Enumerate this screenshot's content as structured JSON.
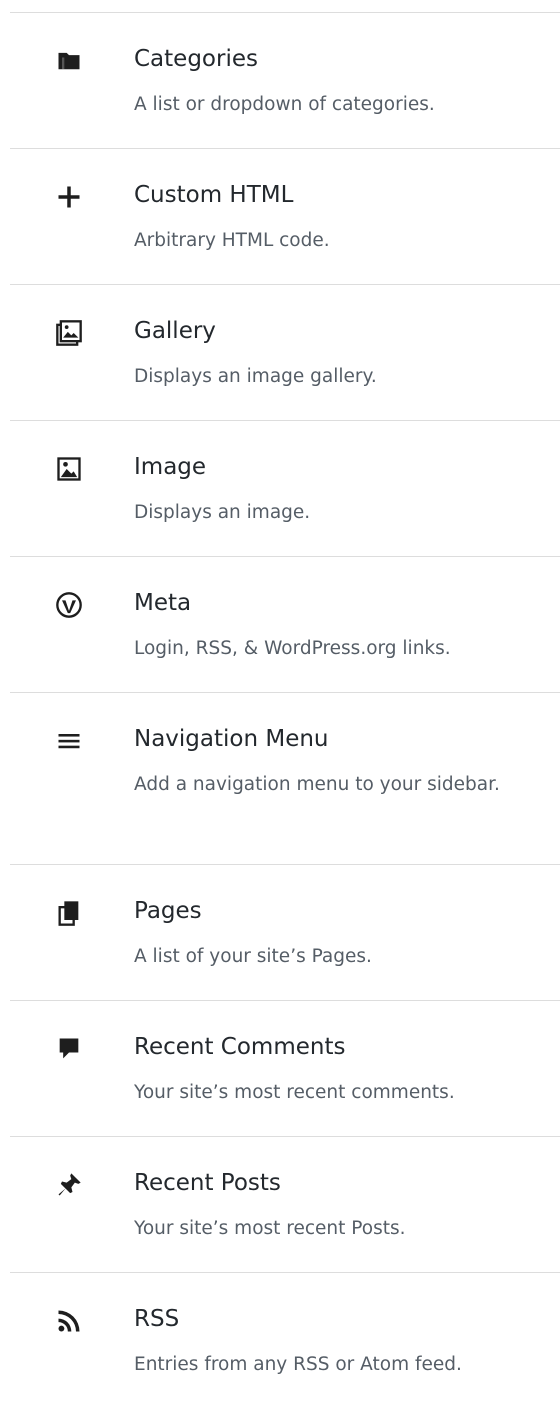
{
  "widgets": [
    {
      "title": "Categories",
      "description": "A list or dropdown of categories.",
      "icon": "folder-icon"
    },
    {
      "title": "Custom HTML",
      "description": "Arbitrary HTML code.",
      "icon": "plus-icon"
    },
    {
      "title": "Gallery",
      "description": "Displays an image gallery.",
      "icon": "gallery-icon"
    },
    {
      "title": "Image",
      "description": "Displays an image.",
      "icon": "image-icon"
    },
    {
      "title": "Meta",
      "description": "Login, RSS, & WordPress.org links.",
      "icon": "wordpress-icon"
    },
    {
      "title": "Navigation Menu",
      "description": "Add a navigation menu to your sidebar.",
      "icon": "menu-icon"
    },
    {
      "title": "Pages",
      "description": "A list of your site’s Pages.",
      "icon": "pages-icon"
    },
    {
      "title": "Recent Comments",
      "description": "Your site’s most recent comments.",
      "icon": "comment-icon"
    },
    {
      "title": "Recent Posts",
      "description": "Your site’s most recent Posts.",
      "icon": "pin-icon"
    },
    {
      "title": "RSS",
      "description": "Entries from any RSS or Atom feed.",
      "icon": "rss-icon"
    }
  ],
  "colors": {
    "title": "#23282d",
    "description": "#555d66",
    "divider": "#dddddd",
    "icon": "#1e1e1e"
  }
}
